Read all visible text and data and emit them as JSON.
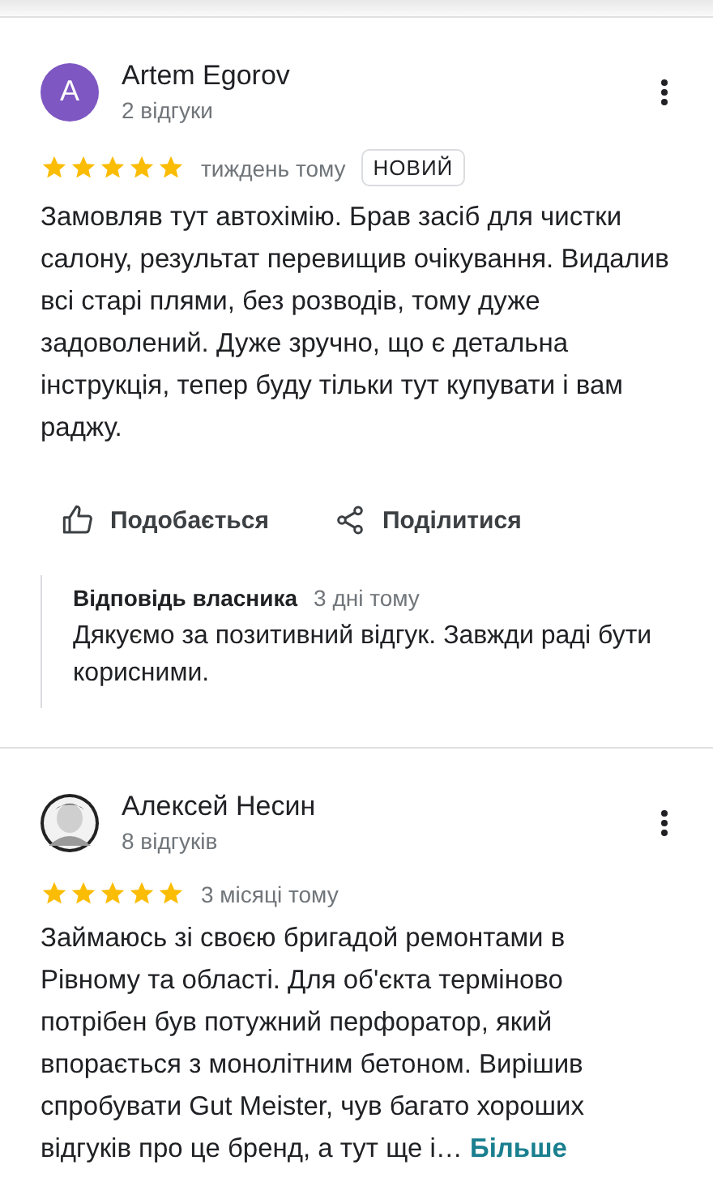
{
  "reviews": [
    {
      "author": "Artem Egorov",
      "avatar": {
        "kind": "letter",
        "letter": "A",
        "color": "#7e57c2"
      },
      "review_count": "2 відгуки",
      "stars": 5,
      "time": "тиждень тому",
      "badge": "НОВИЙ",
      "text": "Замовляв тут автохімію. Брав засіб для чистки салону, результат перевищив очікування. Видалив всі старі плями, без розводів, тому дуже задоволений. Дуже зручно, що є детальна інструкція, тепер буду тільки тут купувати і вам раджу.",
      "actions": [
        {
          "kind": "like",
          "label": "Подобається"
        },
        {
          "kind": "share",
          "label": "Поділитися"
        }
      ],
      "owner_reply": {
        "title": "Відповідь власника",
        "time": "3 дні тому",
        "text": "Дякуємо за позитивний відгук. Завжди раді бути корисними."
      }
    },
    {
      "author": "Алексей Несин",
      "review_count": "8 відгуків",
      "stars": 5,
      "time": "3 місяці тому",
      "text": "Займаюсь зі своєю бригадой ремонтами в Рівному та області. Для об'єкта терміново потрібен був потужний перфоратор, який впорається з монолітним бетоном. Вирішив спробувати Gut Meister, чув багато хороших відгуків про це бренд, а тут ще і…",
      "more": "Більше"
    }
  ]
}
